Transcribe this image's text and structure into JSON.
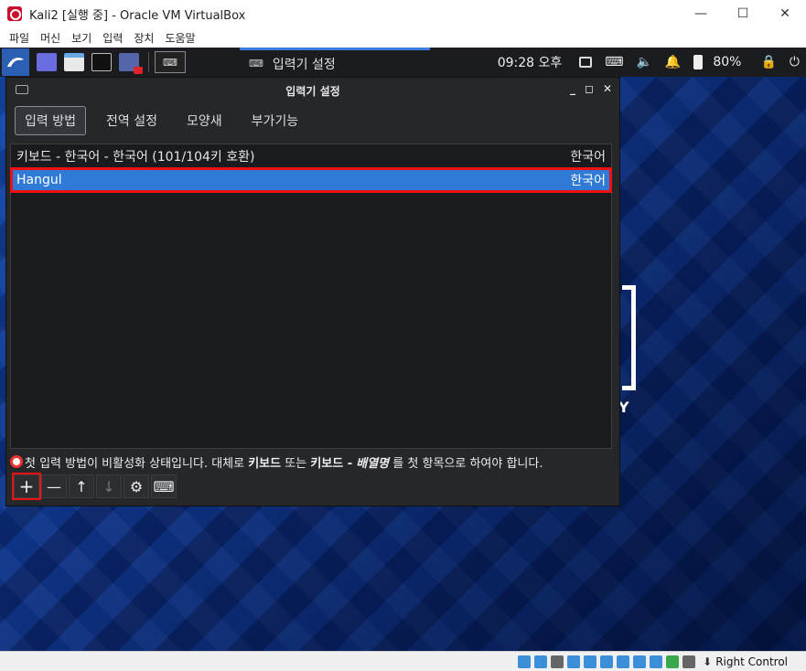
{
  "host": {
    "title": "Kali2 [실행 중] - Oracle VM VirtualBox",
    "window_buttons": [
      "—",
      "☐",
      "✕"
    ],
    "menu": [
      "파일",
      "머신",
      "보기",
      "입력",
      "장치",
      "도움말"
    ]
  },
  "panel": {
    "active_window_label": "입력기 설정",
    "clock": "09:28 오후",
    "battery": "80%"
  },
  "dialog": {
    "title": "입력기 설정",
    "window_controls": [
      "_",
      "◻",
      "✕"
    ],
    "tabs": [
      {
        "label": "입력 방법",
        "active": true
      },
      {
        "label": "전역 설정",
        "active": false
      },
      {
        "label": "모양새",
        "active": false
      },
      {
        "label": "부가기능",
        "active": false
      }
    ],
    "input_methods": [
      {
        "name": "키보드 - 한국어 - 한국어 (101/104키 호환)",
        "language": "한국어",
        "selected": false
      },
      {
        "name": "Hangul",
        "language": "한국어",
        "selected": true
      }
    ],
    "warning": {
      "part1": "첫 입력 방법이 비활성화 상태입니다. 대체로",
      "bold1": "키보드",
      "part2": "또는",
      "bold2": "키보드 -",
      "italic": "배열명",
      "part3": "를 첫 항목으로 하여야 합니다."
    },
    "toolbar": {
      "add": "+",
      "remove": "—",
      "up": "↑",
      "down": "↓",
      "configure": "⚙",
      "keyboard": "⌨"
    }
  },
  "desktop": {
    "fragment_text": "Y"
  },
  "status_bar": {
    "host_key": "Right Control"
  },
  "colors": {
    "selection": "#2f7ad6",
    "highlight_outline": "#e11111",
    "dialog_bg": "#25272b",
    "panel_bg": "#1a1c20"
  }
}
